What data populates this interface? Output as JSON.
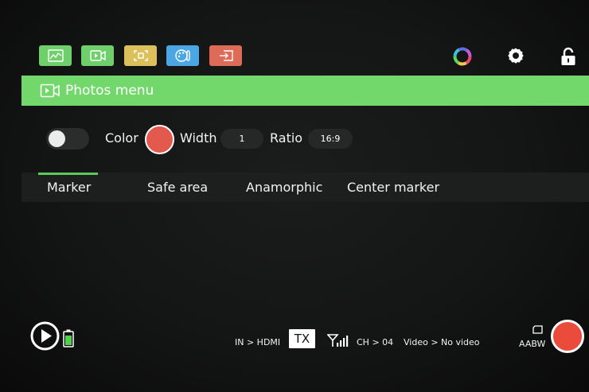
{
  "colors": {
    "accent_green": "#5cc95a",
    "menu_bar": "#72d86b",
    "btn_waveform": "#6fcf6b",
    "btn_video": "#6fcf6b",
    "btn_focus": "#dcc05b",
    "btn_palette": "#4aa7e3",
    "btn_exit": "#de6a58",
    "marker_color": "#e3594d",
    "record": "#ea4b3b",
    "battery_green": "#51d04e"
  },
  "toolbar": {
    "buttons": [
      {
        "icon": "waveform-icon"
      },
      {
        "icon": "video-icon"
      },
      {
        "icon": "focus-icon"
      },
      {
        "icon": "palette-icon"
      },
      {
        "icon": "exit-icon"
      }
    ],
    "right_icons": [
      "color-wheel-icon",
      "gear-icon",
      "lock-icon"
    ]
  },
  "menu": {
    "icon": "video-icon",
    "title": "Photos menu"
  },
  "settings": {
    "toggle_on": false,
    "color_label": "Color",
    "width_label": "Width",
    "width_value": "1",
    "ratio_label": "Ratio",
    "ratio_value": "16:9"
  },
  "tabs": [
    {
      "label": "Marker",
      "active": true
    },
    {
      "label": "Safe area",
      "active": false
    },
    {
      "label": "Anamorphic",
      "active": false
    },
    {
      "label": "Center marker",
      "active": false
    }
  ],
  "status": {
    "input": "IN > HDMI",
    "tx": "TX",
    "channel": "CH > 04",
    "video": "Video > No video",
    "wb": "AABW"
  }
}
